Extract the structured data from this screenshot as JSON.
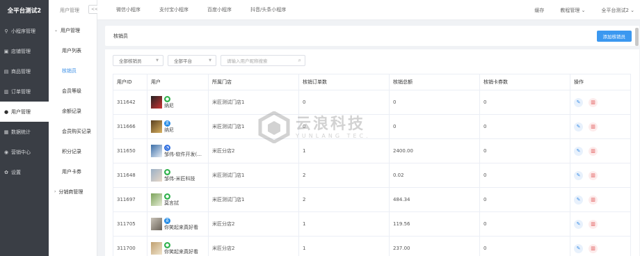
{
  "brand": "全平台测试2",
  "sidebar": {
    "items": [
      {
        "icon": "link-icon",
        "glyph": "⚲",
        "label": "小程序管理"
      },
      {
        "icon": "store-icon",
        "glyph": "▣",
        "label": "店铺管理"
      },
      {
        "icon": "goods-icon",
        "glyph": "▤",
        "label": "商品管理"
      },
      {
        "icon": "order-icon",
        "glyph": "▥",
        "label": "订单管理"
      },
      {
        "icon": "user-icon",
        "glyph": "●",
        "label": "用户管理"
      },
      {
        "icon": "chart-icon",
        "glyph": "▦",
        "label": "数据统计"
      },
      {
        "icon": "marketing-icon",
        "glyph": "◉",
        "label": "营销中心"
      },
      {
        "icon": "gear-icon",
        "glyph": "✿",
        "label": "设置"
      }
    ]
  },
  "subnav": {
    "header": "用户管理",
    "collapse": "<<",
    "group": "用户管理",
    "items": [
      "用户列表",
      "核销员",
      "会员等级",
      "余额记录",
      "会员购买记录",
      "积分记录",
      "用户卡券"
    ],
    "group2": "分销商管理"
  },
  "topbar": {
    "tabs": [
      "微信小程序",
      "支付宝小程序",
      "百度小程序",
      "抖音/头条小程序"
    ],
    "right": [
      "缓存",
      "教程管理 ⌄",
      "全平台测试2 ⌄"
    ]
  },
  "panel": {
    "title": "核销员",
    "add_button": "添加核销员"
  },
  "filters": {
    "writeoff": "全部核销员",
    "platform": "全部平台",
    "search_placeholder": "请输入用户昵称搜索"
  },
  "table": {
    "headers": [
      "用户ID",
      "用户",
      "所属门店",
      "核销订单数",
      "核销总额",
      "核销卡券数",
      "操作"
    ],
    "rows": [
      {
        "id": "311642",
        "platform": "wechat",
        "name": "纳尼",
        "store": "米匠测试门店1",
        "orders": "0",
        "total": "0",
        "cards": "0"
      },
      {
        "id": "311666",
        "platform": "alipay",
        "name": "纳尼",
        "store": "米匠测试门店1",
        "orders": "0",
        "total": "0",
        "cards": "0"
      },
      {
        "id": "311650",
        "platform": "baidu",
        "name": "邹伟-软件开发(...",
        "store": "米匠分店2",
        "orders": "1",
        "total": "2400.00",
        "cards": "0"
      },
      {
        "id": "311648",
        "platform": "wechat",
        "name": "邹伟-米匠科技",
        "store": "米匠测试门店1",
        "orders": "2",
        "total": "0.02",
        "cards": "0"
      },
      {
        "id": "311697",
        "platform": "wechat",
        "name": "莫言拭",
        "store": "米匠测试门店1",
        "orders": "2",
        "total": "484.34",
        "cards": "0"
      },
      {
        "id": "311705",
        "platform": "alipay",
        "name": "你笑起来真好看",
        "store": "米匠分店2",
        "orders": "1",
        "total": "119.56",
        "cards": "0"
      },
      {
        "id": "311700",
        "platform": "wechat",
        "name": "你笑起来真好看",
        "store": "米匠分店2",
        "orders": "1",
        "total": "237.00",
        "cards": "0"
      }
    ]
  },
  "watermark": {
    "title": "云浪科技",
    "sub": "YUNLANG TEC."
  },
  "colors": {
    "primary": "#3b98f0",
    "sidebar_bg": "#3a3e45",
    "wechat": "#2fb14c",
    "alipay": "#1e88e5",
    "baidu": "#2f6fe0",
    "delete": "#e05555"
  }
}
